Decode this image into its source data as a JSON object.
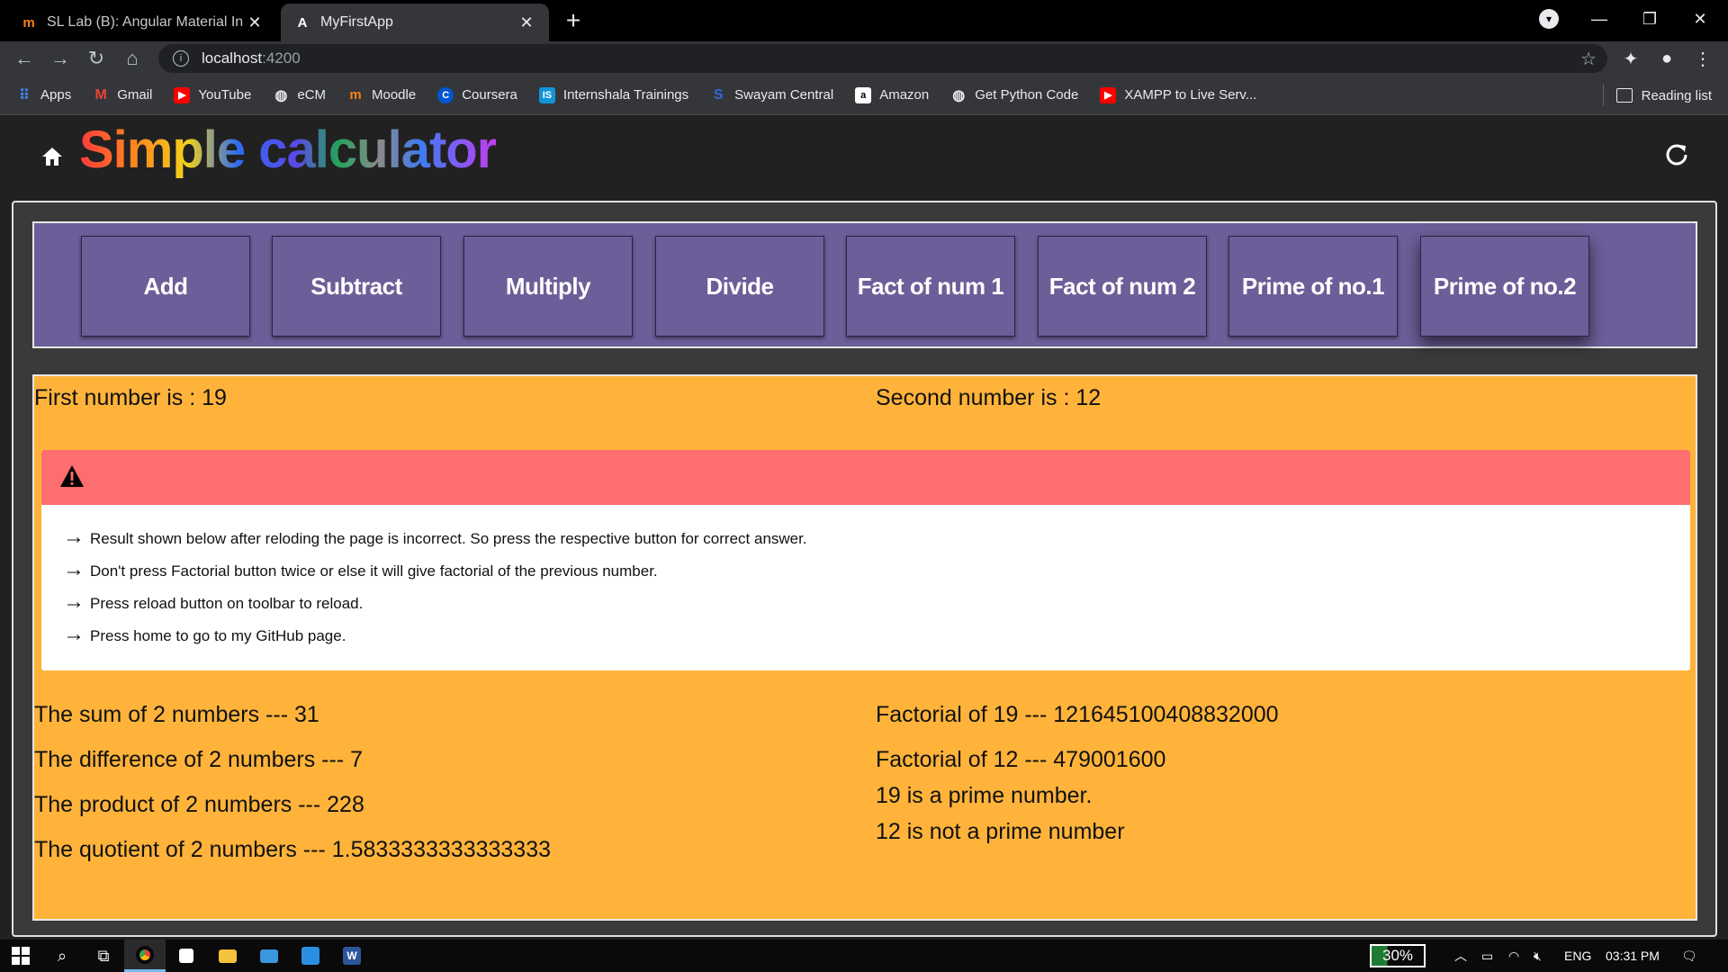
{
  "browser": {
    "tabs": [
      {
        "title": "SL Lab (B): Angular Material In Ca",
        "favicon": "moodle-icon"
      },
      {
        "title": "MyFirstApp",
        "favicon": "angular-icon"
      }
    ],
    "new_tab": "+",
    "url_host": "localhost",
    "url_port": ":4200"
  },
  "bookmarks": {
    "items": [
      {
        "label": "Apps",
        "color": "#4285f4"
      },
      {
        "label": "Gmail",
        "color": "#ea4335"
      },
      {
        "label": "YouTube",
        "color": "#ff0000"
      },
      {
        "label": "eCM",
        "color": "#9aa0a6"
      },
      {
        "label": "Moodle",
        "color": "#f98012"
      },
      {
        "label": "Coursera",
        "color": "#0056d2"
      },
      {
        "label": "Internshala Trainings",
        "color": "#1295d8"
      },
      {
        "label": "Swayam Central",
        "color": "#2d6bd9"
      },
      {
        "label": "Amazon",
        "color": "#ffffff"
      },
      {
        "label": "Get Python Code",
        "color": "#9aa0a6"
      },
      {
        "label": "XAMPP to Live Serv...",
        "color": "#ff0000"
      }
    ],
    "reading_list": "Reading list"
  },
  "app": {
    "title": "Simple calculator",
    "buttons": [
      "Add",
      "Subtract",
      "Multiply",
      "Divide",
      "Fact of num 1",
      "Fact of num 2",
      "Prime of no.1",
      "Prime of no.2"
    ],
    "first_number": "First number is : 19",
    "second_number": "Second number is : 12",
    "notes": [
      "Result shown below after reloding the page is incorrect. So press the respective button for correct answer.",
      "Don't press Factorial button twice or else it will give factorial of the previous number.",
      "Press reload button on toolbar to reload.",
      "Press home to go to my GitHub page."
    ],
    "results_left": [
      "The sum of 2 numbers --- 31",
      "The difference of 2 numbers --- 7",
      "The product of 2 numbers --- 228",
      "The quotient of 2 numbers --- 1.5833333333333333"
    ],
    "results_right": [
      "Factorial of 19 --- 121645100408832000",
      "Factorial of 12 --- 479001600",
      "19 is a prime number.",
      "12 is not a prime number"
    ],
    "colors": {
      "button_panel": "#6c5e98",
      "result_panel": "#ffb33a",
      "warning_header": "#ff6e6e"
    }
  },
  "taskbar": {
    "battery": "30%",
    "language": "ENG",
    "time": "03:31 PM"
  }
}
